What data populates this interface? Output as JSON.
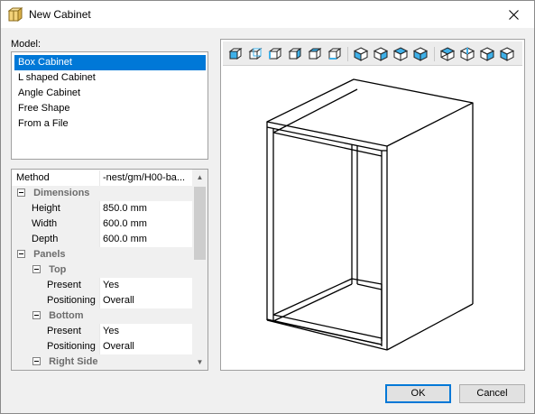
{
  "window": {
    "title": "New Cabinet"
  },
  "model": {
    "label": "Model:",
    "items": [
      "Box Cabinet",
      "L shaped Cabinet",
      "Angle Cabinet",
      "Free Shape",
      "From a File"
    ],
    "selected": "Box Cabinet"
  },
  "properties": {
    "method": {
      "name": "Method",
      "value": "-nest/gm/H00-ba..."
    },
    "dimensions": {
      "title": "Dimensions",
      "height": {
        "name": "Height",
        "value": "850.0 mm"
      },
      "width": {
        "name": "Width",
        "value": "600.0 mm"
      },
      "depth": {
        "name": "Depth",
        "value": "600.0 mm"
      }
    },
    "panels": {
      "title": "Panels",
      "top": {
        "title": "Top",
        "present": {
          "name": "Present",
          "value": "Yes"
        },
        "positioning": {
          "name": "Positioning",
          "value": "Overall"
        }
      },
      "bottom": {
        "title": "Bottom",
        "present": {
          "name": "Present",
          "value": "Yes"
        },
        "positioning": {
          "name": "Positioning",
          "value": "Overall"
        }
      },
      "right_side": {
        "title": "Right Side"
      }
    }
  },
  "toolbar_icons": [
    "view-front-icon",
    "view-back-icon",
    "view-left-icon",
    "view-right-icon",
    "view-top-icon",
    "view-bottom-icon",
    "iso-view-1-icon",
    "iso-view-2-icon",
    "iso-view-3-icon",
    "iso-view-4-icon",
    "iso-view-5-icon",
    "iso-view-6-icon",
    "iso-view-7-icon",
    "iso-view-8-icon"
  ],
  "buttons": {
    "ok": "OK",
    "cancel": "Cancel"
  },
  "colors": {
    "selection": "#0078d7",
    "toolbar_icon_face": "#3fb0e8"
  }
}
